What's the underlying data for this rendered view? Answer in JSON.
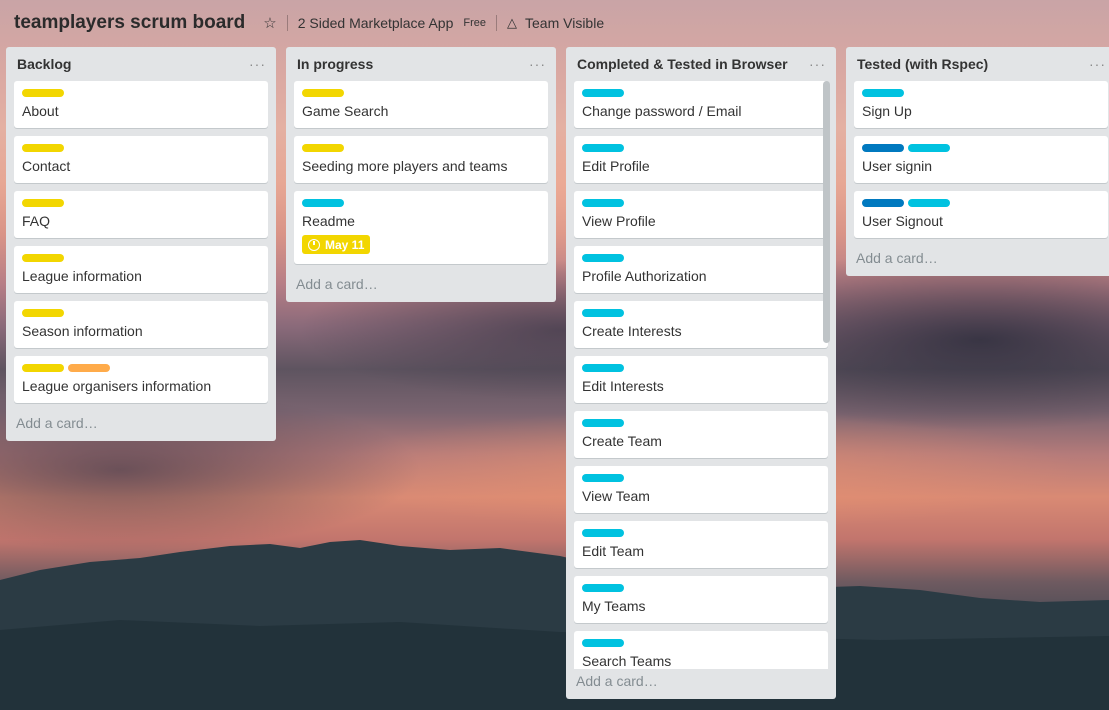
{
  "header": {
    "board_title": "teamplayers scrum board",
    "star_icon": "star-icon",
    "team_name": "2 Sided Marketplace App",
    "plan_badge": "Free",
    "visibility_icon": "team-icon",
    "visibility": "Team Visible"
  },
  "colors": {
    "yellow": "#f2d600",
    "cyan": "#00c2e0",
    "orange": "#ffab4a",
    "blue": "#0079bf",
    "list_bg": "#e2e4e6"
  },
  "lists": [
    {
      "title": "Backlog",
      "menu": "···",
      "cards": [
        {
          "labels": [
            "yellow"
          ],
          "title": "About"
        },
        {
          "labels": [
            "yellow"
          ],
          "title": "Contact"
        },
        {
          "labels": [
            "yellow"
          ],
          "title": "FAQ"
        },
        {
          "labels": [
            "yellow"
          ],
          "title": "League information"
        },
        {
          "labels": [
            "yellow"
          ],
          "title": "Season information"
        },
        {
          "labels": [
            "yellow",
            "orange"
          ],
          "title": "League organisers information"
        }
      ],
      "add_card": "Add a card…"
    },
    {
      "title": "In progress",
      "menu": "···",
      "cards": [
        {
          "labels": [
            "yellow"
          ],
          "title": "Game Search"
        },
        {
          "labels": [
            "yellow"
          ],
          "title": "Seeding more players and teams"
        },
        {
          "labels": [
            "cyan"
          ],
          "title": "Readme",
          "due": "May 11"
        }
      ],
      "add_card": "Add a card…"
    },
    {
      "title": "Completed & Tested in Browser",
      "menu": "···",
      "cards": [
        {
          "labels": [
            "cyan"
          ],
          "title": "Change password / Email"
        },
        {
          "labels": [
            "cyan"
          ],
          "title": "Edit Profile"
        },
        {
          "labels": [
            "cyan"
          ],
          "title": "View Profile"
        },
        {
          "labels": [
            "cyan"
          ],
          "title": "Profile Authorization"
        },
        {
          "labels": [
            "cyan"
          ],
          "title": "Create Interests"
        },
        {
          "labels": [
            "cyan"
          ],
          "title": "Edit Interests"
        },
        {
          "labels": [
            "cyan"
          ],
          "title": "Create Team"
        },
        {
          "labels": [
            "cyan"
          ],
          "title": "View Team"
        },
        {
          "labels": [
            "cyan"
          ],
          "title": "Edit Team"
        },
        {
          "labels": [
            "cyan"
          ],
          "title": "My Teams"
        },
        {
          "labels": [
            "cyan"
          ],
          "title": "Search Teams"
        }
      ],
      "add_card": "Add a card…"
    },
    {
      "title": "Tested (with Rspec)",
      "menu": "···",
      "cards": [
        {
          "labels": [
            "cyan"
          ],
          "title": "Sign Up"
        },
        {
          "labels": [
            "blue",
            "cyan"
          ],
          "title": "User signin"
        },
        {
          "labels": [
            "blue",
            "cyan"
          ],
          "title": "User Signout"
        }
      ],
      "add_card": "Add a card…"
    }
  ]
}
